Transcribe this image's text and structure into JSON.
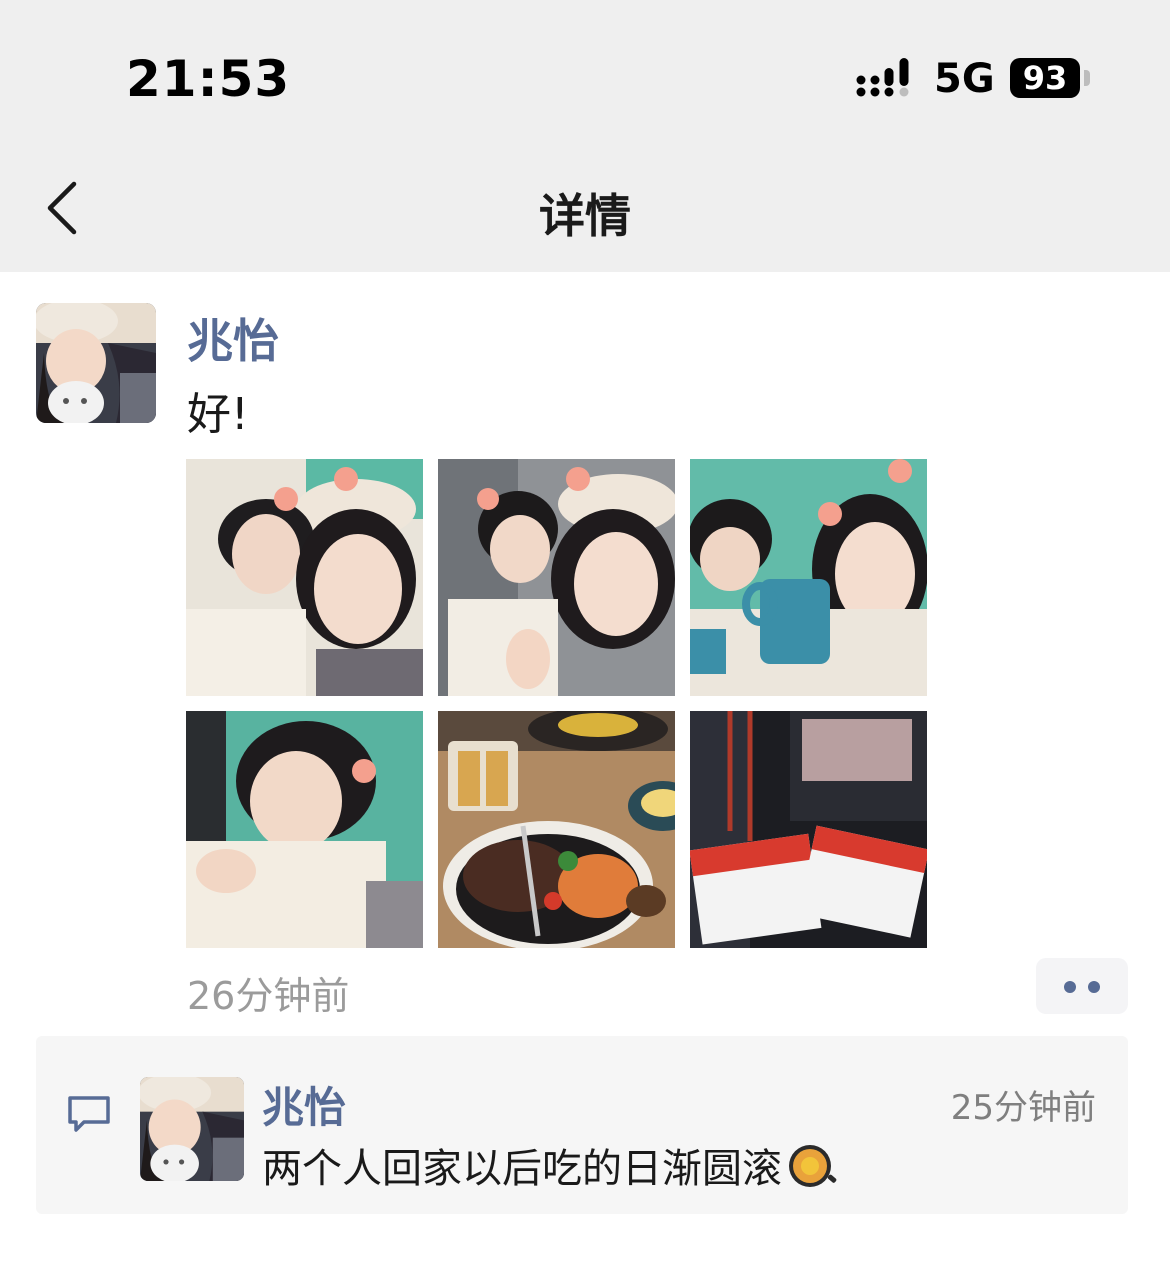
{
  "status_bar": {
    "time": "21:53",
    "network": "5G",
    "battery": "93"
  },
  "nav": {
    "title": "详情",
    "back_icon": "chevron-left-icon"
  },
  "post": {
    "author": "兆怡",
    "text": "好!",
    "time": "26分钟前",
    "photos": [
      {
        "subject": "selfie-1"
      },
      {
        "subject": "selfie-peace-sign"
      },
      {
        "subject": "selfie-mug"
      },
      {
        "subject": "selfie-hand-chin"
      },
      {
        "subject": "food-plates"
      },
      {
        "subject": "movie-tickets"
      }
    ]
  },
  "comment": {
    "author": "兆怡",
    "time": "25分钟前",
    "text": "两个人回家以后吃的日渐圆滚",
    "emoji": "fried-egg-pan-icon"
  },
  "colors": {
    "link_blue": "#576b95",
    "bar_bg": "#efefef",
    "comment_bg": "#f6f6f6"
  }
}
